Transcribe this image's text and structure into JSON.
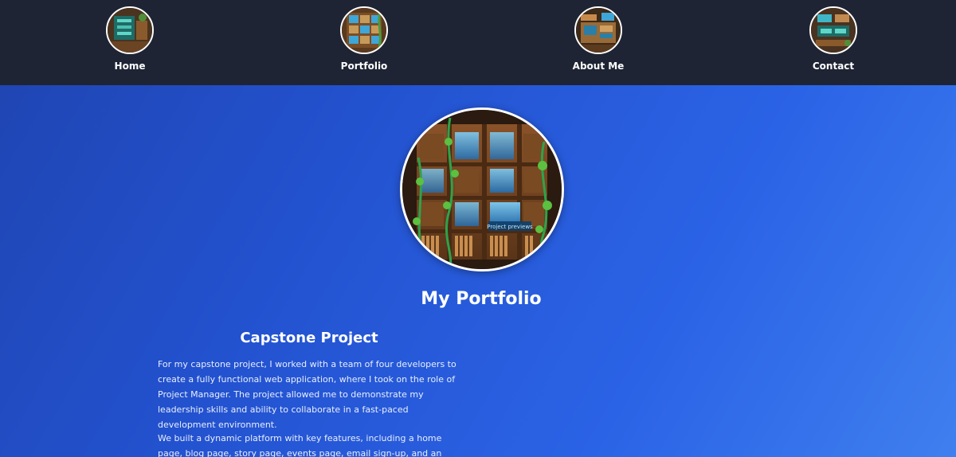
{
  "nav": {
    "items": [
      {
        "label": "Home"
      },
      {
        "label": "Portfolio"
      },
      {
        "label": "About Me"
      },
      {
        "label": "Contact"
      }
    ]
  },
  "hero": {
    "image_name": "bookshelf-project-previews-image",
    "image_sign_text": "Project previews"
  },
  "main": {
    "title": "My Portfolio",
    "section": {
      "title": "Capstone Project",
      "paragraph1": "For my capstone project, I worked with a team of four developers to create a fully functional web application, where I took on the role of Project Manager. The project allowed me to demonstrate my leadership skills and ability to collaborate in a fast-paced development environment.",
      "paragraph2": "We built a dynamic platform with key features, including a home page, blog page, story page, events page, email sign-up, and an admin profile"
    }
  },
  "colors": {
    "nav_background": "#1e2433",
    "page_gradient_start": "#1f44b0",
    "page_gradient_end": "#3f7fef",
    "text": "#ffffff"
  }
}
